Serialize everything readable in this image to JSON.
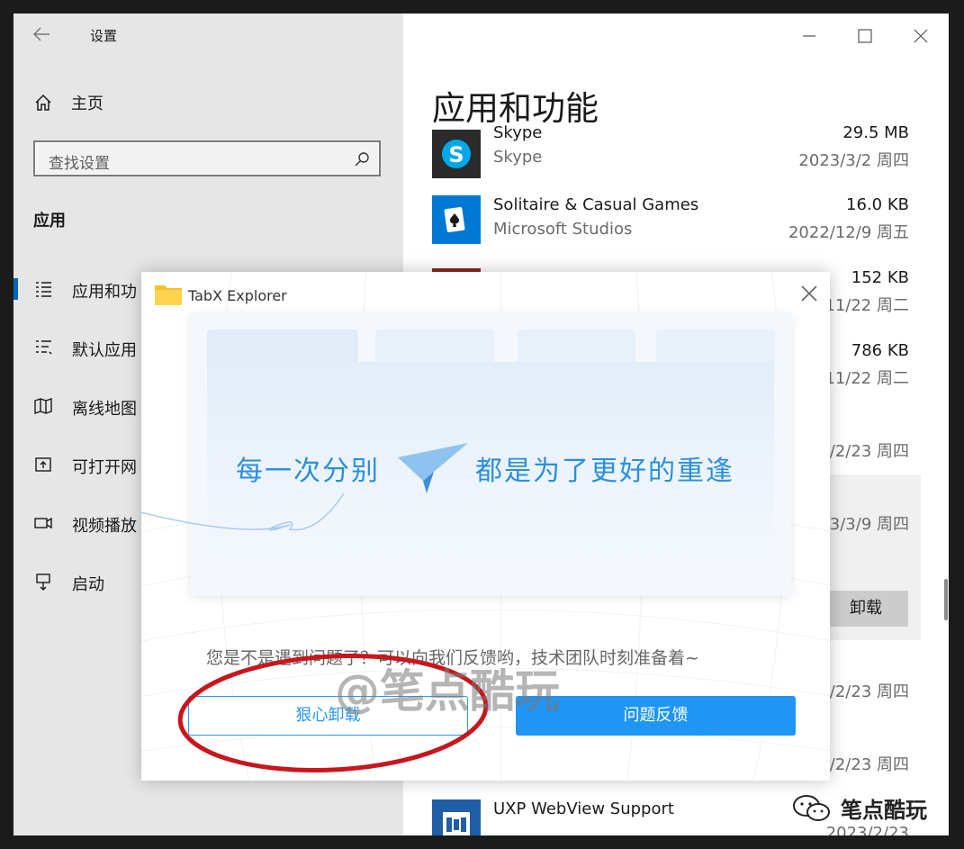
{
  "window": {
    "title": "设置"
  },
  "sidebar": {
    "home_label": "主页",
    "search_placeholder": "查找设置",
    "section_title": "应用",
    "items": [
      {
        "label": "应用和功",
        "icon": "apps-list-icon",
        "active": true
      },
      {
        "label": "默认应用",
        "icon": "default-apps-icon"
      },
      {
        "label": "离线地图",
        "icon": "offline-maps-icon"
      },
      {
        "label": "可打开网",
        "icon": "open-website-icon"
      },
      {
        "label": "视频播放",
        "icon": "video-playback-icon"
      },
      {
        "label": "启动",
        "icon": "startup-icon"
      }
    ]
  },
  "main": {
    "title": "应用和功能",
    "apps": [
      {
        "name": "Skype",
        "publisher": "Skype",
        "size": "29.5 MB",
        "date": "2023/3/2 周四"
      },
      {
        "name": "Solitaire & Casual Games",
        "publisher": "Microsoft Studios",
        "size": "16.0 KB",
        "date": "2022/12/9 周五"
      },
      {
        "name": "",
        "publisher": "",
        "size": "152 KB",
        "date": "11/22 周二"
      },
      {
        "name": "",
        "publisher": "",
        "size": "786 KB",
        "date": "11/22 周二"
      },
      {
        "name": "",
        "publisher": "",
        "size": "",
        "date": "/2/23 周四"
      },
      {
        "name": "",
        "publisher": "",
        "size": "",
        "date": "3/3/9 周四"
      },
      {
        "name": "",
        "publisher": "",
        "size": "",
        "date": "/2/23 周四"
      },
      {
        "name": "",
        "publisher": "",
        "size": "",
        "date": "/2/23 周四"
      },
      {
        "name": "UXP WebView Support",
        "publisher": "",
        "size": "",
        "date": "2023/2/23"
      }
    ],
    "uninstall_label": "卸载"
  },
  "dialog": {
    "title": "TabX Explorer",
    "slogan_left": "每一次分别",
    "slogan_right": "都是为了更好的重逢",
    "message": "您是不是遇到问题了？可以向我们反馈哟，技术团队时刻准备着~",
    "uninstall_button": "狠心卸载",
    "feedback_button": "问题反馈"
  },
  "watermark": "@笔点酷玩",
  "corner_watermark": "笔点酷玩",
  "colors": {
    "accent": "#0067c0",
    "dialog_primary": "#1e96f5",
    "annotation_red": "#c8161d",
    "skype_blue": "#00a8e8",
    "solitaire_blue": "#0078d4"
  }
}
